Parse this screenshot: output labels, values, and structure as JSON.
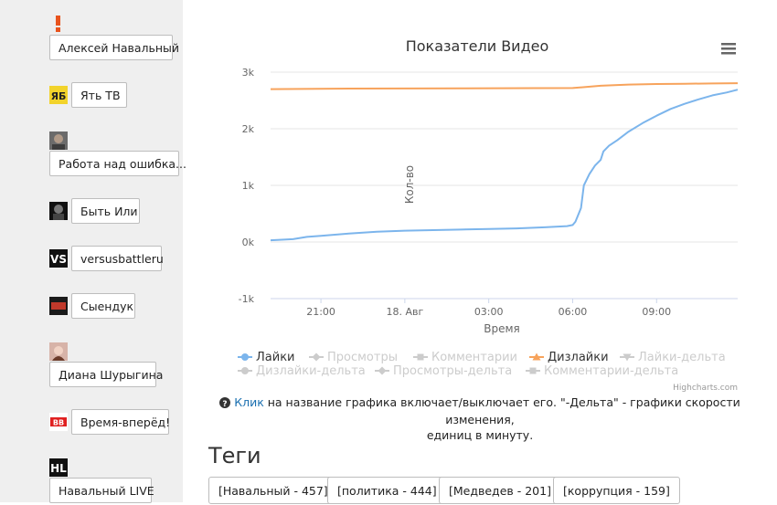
{
  "sidebar": {
    "channels": [
      {
        "name": "Алексей Навальный",
        "icon": "navalny-exclamation-icon"
      },
      {
        "name": "Ять ТВ",
        "icon": "yat-tv-logo-icon"
      },
      {
        "name": "Работа над ошибка...",
        "icon": "user-photo-icon"
      },
      {
        "name": "Быть Или",
        "icon": "byt-ili-logo-icon"
      },
      {
        "name": "versusbattleru",
        "icon": "versus-logo-icon"
      },
      {
        "name": "Сыендук",
        "icon": "syenduk-logo-icon"
      },
      {
        "name": "Диана Шурыгина",
        "icon": "diana-photo-icon"
      },
      {
        "name": "Время-вперёд!",
        "icon": "vremya-vpered-logo-icon"
      },
      {
        "name": "Навальный LIVE",
        "icon": "navalny-live-logo-icon"
      }
    ]
  },
  "chart": {
    "menu_icon": "hamburger-menu-icon",
    "credits": "Highcharts.com",
    "legend": [
      {
        "label": "Лайки",
        "active": true,
        "color": "#7cb5ec",
        "marker": "circle"
      },
      {
        "label": "Просмотры",
        "active": false,
        "color": "#cccccc",
        "marker": "diamond"
      },
      {
        "label": "Комментарии",
        "active": false,
        "color": "#cccccc",
        "marker": "square"
      },
      {
        "label": "Дизлайки",
        "active": true,
        "color": "#f7a35c",
        "marker": "triangle"
      },
      {
        "label": "Лайки-дельта",
        "active": false,
        "color": "#cccccc",
        "marker": "triangle-down"
      },
      {
        "label": "Дизлайки-дельта",
        "active": false,
        "color": "#cccccc",
        "marker": "circle"
      },
      {
        "label": "Просмотры-дельта",
        "active": false,
        "color": "#cccccc",
        "marker": "diamond"
      },
      {
        "label": "Комментарии-дельта",
        "active": false,
        "color": "#cccccc",
        "marker": "square"
      }
    ]
  },
  "chart_data": {
    "type": "line",
    "title": "Показатели Видео",
    "xlabel": "Время",
    "ylabel": "Кол-во",
    "x_ticks": [
      "21:00",
      "18. Авг",
      "03:00",
      "06:00",
      "09:00"
    ],
    "y_ticks": [
      "-1k",
      "0k",
      "1k",
      "2k",
      "3k"
    ],
    "ylim": [
      -1000,
      3000
    ],
    "x_unit": "hours after 18:00, 17 Aug",
    "xlim": [
      1.2,
      17.9
    ],
    "grid": true,
    "legend_position": "bottom",
    "series": [
      {
        "name": "Лайки",
        "color": "#7cb5ec",
        "x": [
          1.2,
          2.0,
          2.5,
          3.0,
          4.0,
          5.0,
          6.0,
          7.0,
          8.0,
          9.0,
          10.0,
          11.0,
          11.8,
          12.0,
          12.1,
          12.3,
          12.4,
          12.6,
          12.8,
          13.0,
          13.1,
          13.3,
          13.6,
          14.0,
          14.5,
          15.0,
          15.5,
          16.0,
          16.5,
          17.0,
          17.5,
          17.9
        ],
        "y": [
          30,
          50,
          90,
          110,
          150,
          180,
          200,
          210,
          220,
          230,
          240,
          260,
          280,
          300,
          360,
          600,
          1000,
          1200,
          1350,
          1450,
          1600,
          1700,
          1800,
          1950,
          2100,
          2230,
          2350,
          2440,
          2520,
          2590,
          2640,
          2690
        ]
      },
      {
        "name": "Дизлайки",
        "color": "#f7a35c",
        "x": [
          1.2,
          4.0,
          8.0,
          12.0,
          13.0,
          14.0,
          15.0,
          16.0,
          17.0,
          17.9
        ],
        "y": [
          2700,
          2710,
          2715,
          2720,
          2760,
          2780,
          2790,
          2795,
          2800,
          2805
        ]
      }
    ]
  },
  "info": {
    "icon": "question-circle-icon",
    "link_text": "Клик",
    "text_line1": " на название графика включает/выключает его. \"-Дельта\" - графики скорости изменения,",
    "text_line2": "единиц в минуту."
  },
  "tags": {
    "title": "Теги",
    "items": [
      "[Навальный - 457]",
      "[политика - 444]",
      "[Медведев - 201]",
      "[коррупция - 159]"
    ]
  }
}
